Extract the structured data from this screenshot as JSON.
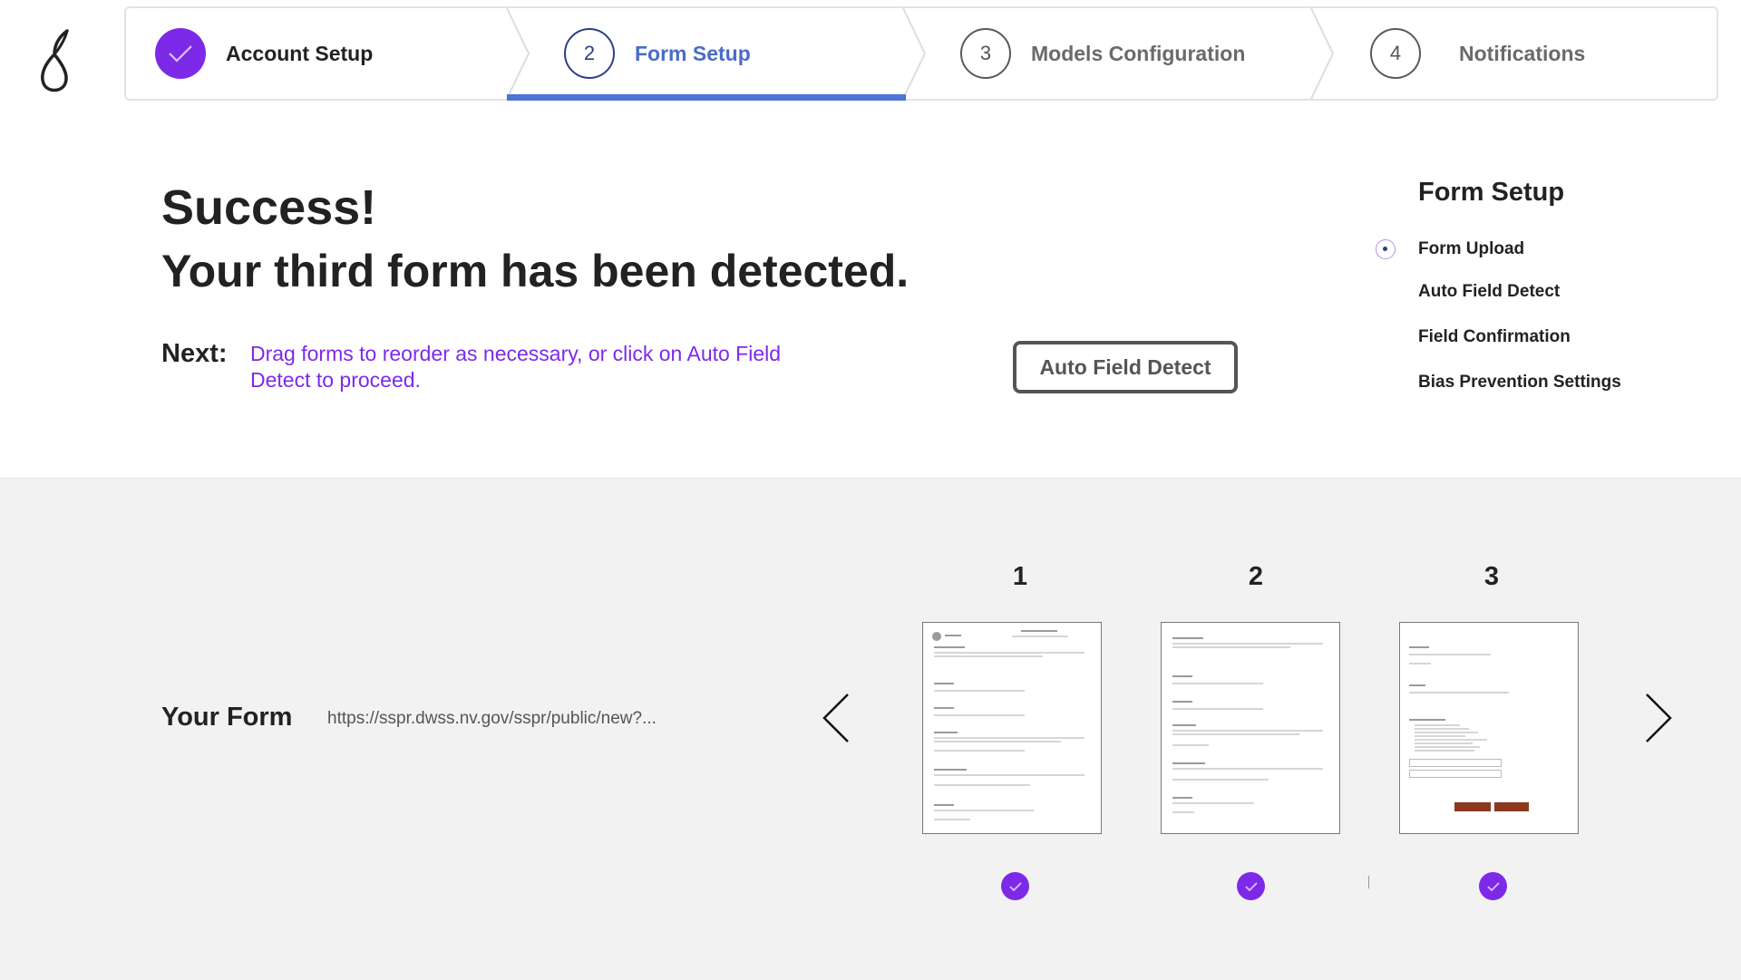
{
  "stepper": {
    "steps": [
      {
        "number": "",
        "label": "Account Setup",
        "state": "done"
      },
      {
        "number": "2",
        "label": "Form Setup",
        "state": "active"
      },
      {
        "number": "3",
        "label": "Models Configuration",
        "state": "pending"
      },
      {
        "number": "4",
        "label": "Notifications",
        "state": "pending"
      }
    ]
  },
  "main": {
    "heading": "Success!",
    "subheading": "Your third form has been detected.",
    "next_label": "Next:",
    "next_text": "Drag forms to reorder as necessary, or click on Auto Field Detect to proceed.",
    "primary_button": "Auto Field Detect"
  },
  "side_panel": {
    "title": "Form Setup",
    "items": [
      "Form Upload",
      "Auto Field Detect",
      "Field Confirmation",
      "Bias Prevention Settings"
    ],
    "current_index": 0
  },
  "form_panel": {
    "label": "Your Form",
    "url": "https://sspr.dwss.nv.gov/sspr/public/new?...",
    "pages": [
      {
        "number": "1",
        "selected": true
      },
      {
        "number": "2",
        "selected": true
      },
      {
        "number": "3",
        "selected": true
      }
    ]
  },
  "colors": {
    "accent": "#7d2ae8",
    "active_step": "#4a6cc7",
    "progress_bar": "#4c73d6",
    "panel_bg": "#f2f2f3"
  },
  "icons": {
    "logo": "pear-logo",
    "step_done": "checkmark-icon",
    "prev": "chevron-left-icon",
    "next": "chevron-right-icon",
    "page_selected": "checkmark-icon"
  }
}
